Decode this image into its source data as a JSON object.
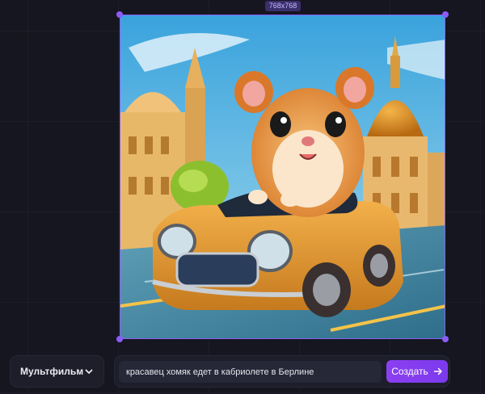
{
  "canvas": {
    "size_badge": "768x768",
    "frame_accent": "#8b5cf6",
    "image_alt": "cartoon hamster driving a convertible car in Berlin"
  },
  "style_select": {
    "value": "Мультфильм",
    "icon": "chevron-down-icon"
  },
  "prompt": {
    "value": "красавец хомяк едет в кабриолете в Берлине"
  },
  "create_button": {
    "label": "Создать",
    "icon": "arrow-right-icon",
    "color": "#7c3aed"
  }
}
